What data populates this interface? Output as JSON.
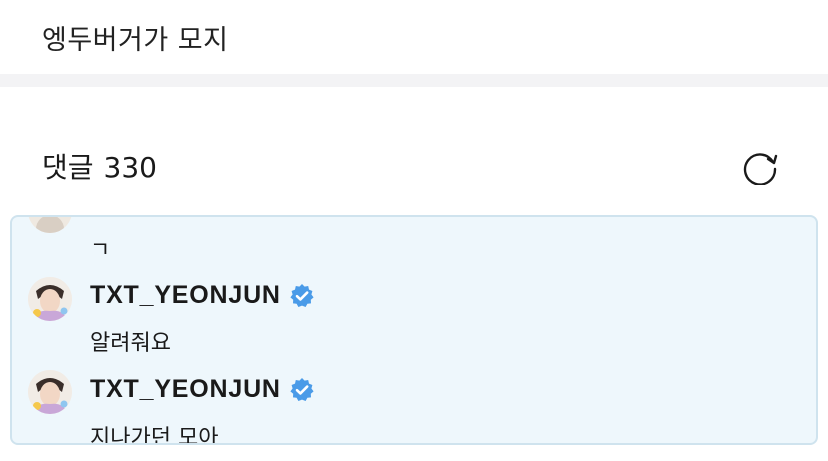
{
  "post": {
    "text": "엥두버거가 모지"
  },
  "comments": {
    "label": "댓글",
    "count": "330",
    "refresh_icon": "refresh-icon",
    "items": [
      {
        "text": "ㄱ"
      },
      {
        "username": "TXT_YEONJUN",
        "verified": true,
        "text": "알려줘요"
      },
      {
        "username": "TXT_YEONJUN",
        "verified": true,
        "text": "지나가던 모아"
      }
    ]
  },
  "colors": {
    "highlight_bg": "#eef7fc",
    "highlight_border": "#cfe3ee",
    "verified_badge": "#4a9be8",
    "divider": "#f3f3f5"
  }
}
